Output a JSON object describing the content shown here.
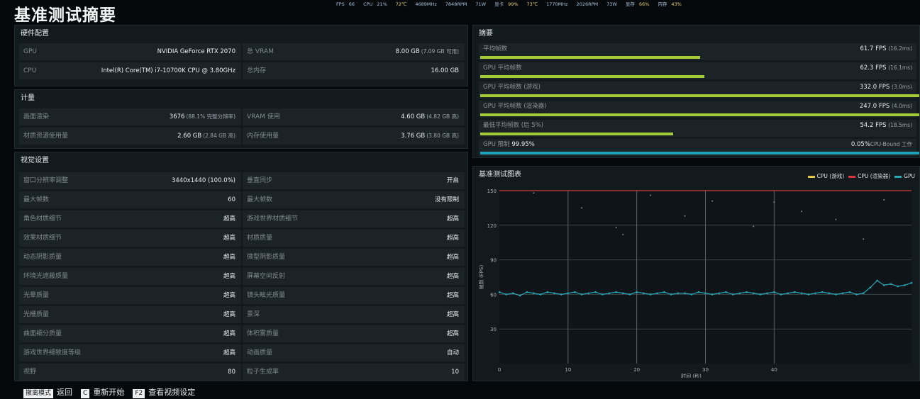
{
  "title": "基准测试摘要",
  "overlay": [
    {
      "k": "FPS",
      "v": "66"
    },
    {
      "k": "CPU",
      "v": "21%"
    },
    {
      "k": "",
      "v": "72℃",
      "y": true
    },
    {
      "k": "",
      "v": "4689MHz"
    },
    {
      "k": "",
      "v": "7848RPM"
    },
    {
      "k": "",
      "v": "71W"
    },
    {
      "k": "显卡",
      "v": "99%",
      "y": true
    },
    {
      "k": "",
      "v": "73℃",
      "y": true
    },
    {
      "k": "",
      "v": "1770MHz"
    },
    {
      "k": "",
      "v": "2026RPM"
    },
    {
      "k": "",
      "v": "73W"
    },
    {
      "k": "显存",
      "v": "66%",
      "y": true
    },
    {
      "k": "内存",
      "v": "43%",
      "y": true
    }
  ],
  "hardware": {
    "title": "硬件配置",
    "rows": [
      {
        "label": "GPU",
        "value": "NVIDIA GeForce RTX 2070",
        "sub": ""
      },
      {
        "label": "总 VRAM",
        "value": "8.00 GB",
        "sub": "(7.09 GB 可用)"
      },
      {
        "label": "CPU",
        "value": "Intel(R) Core(TM) i7-10700K CPU @ 3.80GHz",
        "sub": ""
      },
      {
        "label": "总内存",
        "value": "16.00 GB",
        "sub": ""
      }
    ]
  },
  "metrics": {
    "title": "计量",
    "rows": [
      {
        "label": "画面渲染",
        "value": "3676",
        "sub": "(88.1% 完整分辨率)"
      },
      {
        "label": "VRAM 使用",
        "value": "4.60 GB",
        "sub": "(4.82 GB 高)"
      },
      {
        "label": "材质资源使用量",
        "value": "2.60 GB",
        "sub": "(2.84 GB 高)"
      },
      {
        "label": "内存使用量",
        "value": "3.76 GB",
        "sub": "(3.80 GB 高)"
      }
    ]
  },
  "visual": {
    "title": "视觉设置",
    "rows": [
      {
        "label": "窗口分辨率调整",
        "value": "3440x1440 (100.0%)"
      },
      {
        "label": "垂直同步",
        "value": "开启"
      },
      {
        "label": "最大帧数",
        "value": "60"
      },
      {
        "label": "最大帧数",
        "value": "没有限制"
      },
      {
        "label": "角色材质细节",
        "value": "超高"
      },
      {
        "label": "游戏世界材质细节",
        "value": "超高"
      },
      {
        "label": "效果材质细节",
        "value": "超高"
      },
      {
        "label": "材质质量",
        "value": "超高"
      },
      {
        "label": "动态阴影质量",
        "value": "超高"
      },
      {
        "label": "微型阴影质量",
        "value": "超高"
      },
      {
        "label": "环境光遮蔽质量",
        "value": "超高"
      },
      {
        "label": "屏幕空间反射",
        "value": "超高"
      },
      {
        "label": "光晕质量",
        "value": "超高"
      },
      {
        "label": "镜头眩光质量",
        "value": "超高"
      },
      {
        "label": "光栅质量",
        "value": "超高"
      },
      {
        "label": "景深",
        "value": "超高"
      },
      {
        "label": "曲面细分质量",
        "value": "超高"
      },
      {
        "label": "体积雾质量",
        "value": "超高"
      },
      {
        "label": "游戏世界细致度等级",
        "value": "超高"
      },
      {
        "label": "动画质量",
        "value": "自动"
      },
      {
        "label": "视野",
        "value": "80"
      },
      {
        "label": "粒子生成率",
        "value": "10"
      }
    ]
  },
  "summary": {
    "title": "摘要",
    "rows": [
      {
        "label": "平均帧数",
        "value": "61.7 FPS",
        "sub": "(16.2ms)",
        "fraction": 0.5,
        "color": "#a3cb38"
      },
      {
        "label": "GPU 平均帧数",
        "value": "62.3 FPS",
        "sub": "(16.1ms)",
        "fraction": 0.51,
        "color": "#a3cb38"
      },
      {
        "label": "GPU 平均帧数 (游戏)",
        "value": "332.0 FPS",
        "sub": "(3.0ms)",
        "fraction": 1.0,
        "color": "#a3cb38"
      },
      {
        "label": "GPU 平均帧数 (渲染器)",
        "value": "247.0 FPS",
        "sub": "(4.0ms)",
        "fraction": 1.0,
        "color": "#a3cb38"
      },
      {
        "label": "最低平均帧数 (后 5%)",
        "value": "54.2 FPS",
        "sub": "(18.5ms)",
        "fraction": 0.44,
        "color": "#a3cb38"
      }
    ],
    "limit": {
      "label": "GPU 限制",
      "value": "99.95%",
      "right_value": "0.05%",
      "right_label": "CPU-Bound 工作",
      "fraction": 0.9995,
      "color": "#1ea3b8"
    }
  },
  "chart_panel": {
    "title": "基准测试图表",
    "legend": [
      {
        "label": "CPU (游戏)",
        "color": "#e3c443"
      },
      {
        "label": "CPU (渲染器)",
        "color": "#d23a3a"
      },
      {
        "label": "GPU",
        "color": "#2aa7b5"
      }
    ]
  },
  "chart_data": {
    "type": "scatter",
    "xlabel": "时间 (秒)",
    "ylabel": "帧数 (FPS)",
    "xlim": [
      0,
      60
    ],
    "ylim": [
      0,
      150
    ],
    "xticks": [
      0,
      10,
      20,
      30,
      40
    ],
    "yticks": [
      30,
      60,
      90,
      120,
      150
    ],
    "grid": true,
    "series": [
      {
        "name": "CPU (渲染器)",
        "values": [
          [
            0,
            150
          ],
          [
            60,
            150
          ]
        ]
      },
      {
        "name": "CPU (游戏)",
        "values": [
          [
            5,
            148
          ],
          [
            12,
            135
          ],
          [
            17,
            118
          ],
          [
            18,
            112
          ],
          [
            22,
            146
          ],
          [
            27,
            128
          ],
          [
            31,
            141
          ],
          [
            37,
            119
          ],
          [
            40,
            140
          ],
          [
            44,
            132
          ],
          [
            49,
            125
          ],
          [
            53,
            108
          ],
          [
            56,
            142
          ]
        ]
      },
      {
        "name": "GPU",
        "values": [
          [
            0,
            62
          ],
          [
            1,
            60
          ],
          [
            2,
            61
          ],
          [
            3,
            59
          ],
          [
            4,
            62
          ],
          [
            5,
            61
          ],
          [
            6,
            60
          ],
          [
            7,
            62
          ],
          [
            8,
            61
          ],
          [
            9,
            60
          ],
          [
            10,
            61
          ],
          [
            11,
            62
          ],
          [
            12,
            60
          ],
          [
            13,
            61
          ],
          [
            14,
            62
          ],
          [
            15,
            60
          ],
          [
            16,
            61
          ],
          [
            17,
            62
          ],
          [
            18,
            61
          ],
          [
            19,
            60
          ],
          [
            20,
            62
          ],
          [
            21,
            61
          ],
          [
            22,
            60
          ],
          [
            23,
            61
          ],
          [
            24,
            62
          ],
          [
            25,
            60
          ],
          [
            26,
            61
          ],
          [
            27,
            61
          ],
          [
            28,
            60
          ],
          [
            29,
            62
          ],
          [
            30,
            61
          ],
          [
            31,
            60
          ],
          [
            32,
            61
          ],
          [
            33,
            62
          ],
          [
            34,
            60
          ],
          [
            35,
            61
          ],
          [
            36,
            62
          ],
          [
            37,
            61
          ],
          [
            38,
            60
          ],
          [
            39,
            61
          ],
          [
            40,
            62
          ],
          [
            41,
            60
          ],
          [
            42,
            61
          ],
          [
            43,
            62
          ],
          [
            44,
            61
          ],
          [
            45,
            60
          ],
          [
            46,
            61
          ],
          [
            47,
            62
          ],
          [
            48,
            61
          ],
          [
            49,
            60
          ],
          [
            50,
            61
          ],
          [
            51,
            62
          ],
          [
            52,
            60
          ],
          [
            53,
            61
          ],
          [
            54,
            66
          ],
          [
            55,
            72
          ],
          [
            56,
            68
          ],
          [
            57,
            69
          ],
          [
            58,
            67
          ],
          [
            59,
            68
          ],
          [
            60,
            70
          ]
        ]
      }
    ]
  },
  "footer": [
    {
      "key": "撤离模式",
      "label": "返回"
    },
    {
      "key": "C",
      "label": "重新开始"
    },
    {
      "key": "F2",
      "label": "查看视频设定"
    }
  ]
}
